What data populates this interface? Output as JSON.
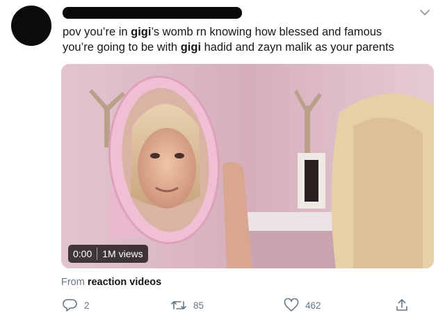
{
  "tweet": {
    "line1_pre": "pov you’re in ",
    "line1_bold": "gigi",
    "line1_post": "’s womb rn knowing how blessed and famous",
    "line2_pre": "you’re going to be with ",
    "line2_bold": "gigi",
    "line2_post": " hadid and zayn malik as your parents"
  },
  "video": {
    "time": "0:00",
    "views": "1M views"
  },
  "source": {
    "prefix": "From",
    "name": "reaction videos"
  },
  "actions": {
    "reply_count": "2",
    "retweet_count": "85",
    "like_count": "462"
  },
  "icons": [
    "chevron-down-icon",
    "reply-icon",
    "retweet-icon",
    "like-icon",
    "share-icon"
  ],
  "colors": {
    "text": "#14171a",
    "muted": "#657786"
  }
}
